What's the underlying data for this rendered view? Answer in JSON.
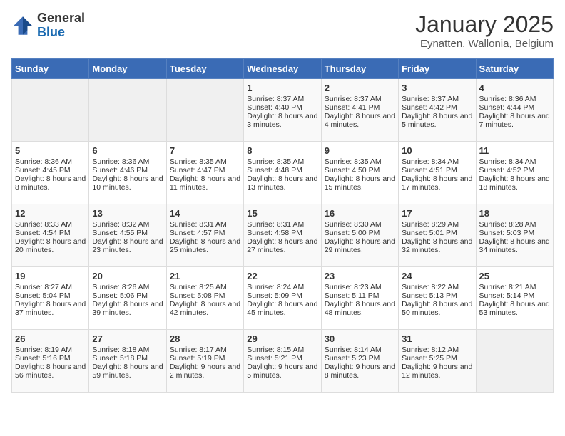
{
  "header": {
    "logo_general": "General",
    "logo_blue": "Blue",
    "month": "January 2025",
    "location": "Eynatten, Wallonia, Belgium"
  },
  "days_of_week": [
    "Sunday",
    "Monday",
    "Tuesday",
    "Wednesday",
    "Thursday",
    "Friday",
    "Saturday"
  ],
  "weeks": [
    [
      {
        "day": "",
        "content": ""
      },
      {
        "day": "",
        "content": ""
      },
      {
        "day": "",
        "content": ""
      },
      {
        "day": "1",
        "content": "Sunrise: 8:37 AM\nSunset: 4:40 PM\nDaylight: 8 hours and 3 minutes."
      },
      {
        "day": "2",
        "content": "Sunrise: 8:37 AM\nSunset: 4:41 PM\nDaylight: 8 hours and 4 minutes."
      },
      {
        "day": "3",
        "content": "Sunrise: 8:37 AM\nSunset: 4:42 PM\nDaylight: 8 hours and 5 minutes."
      },
      {
        "day": "4",
        "content": "Sunrise: 8:36 AM\nSunset: 4:44 PM\nDaylight: 8 hours and 7 minutes."
      }
    ],
    [
      {
        "day": "5",
        "content": "Sunrise: 8:36 AM\nSunset: 4:45 PM\nDaylight: 8 hours and 8 minutes."
      },
      {
        "day": "6",
        "content": "Sunrise: 8:36 AM\nSunset: 4:46 PM\nDaylight: 8 hours and 10 minutes."
      },
      {
        "day": "7",
        "content": "Sunrise: 8:35 AM\nSunset: 4:47 PM\nDaylight: 8 hours and 11 minutes."
      },
      {
        "day": "8",
        "content": "Sunrise: 8:35 AM\nSunset: 4:48 PM\nDaylight: 8 hours and 13 minutes."
      },
      {
        "day": "9",
        "content": "Sunrise: 8:35 AM\nSunset: 4:50 PM\nDaylight: 8 hours and 15 minutes."
      },
      {
        "day": "10",
        "content": "Sunrise: 8:34 AM\nSunset: 4:51 PM\nDaylight: 8 hours and 17 minutes."
      },
      {
        "day": "11",
        "content": "Sunrise: 8:34 AM\nSunset: 4:52 PM\nDaylight: 8 hours and 18 minutes."
      }
    ],
    [
      {
        "day": "12",
        "content": "Sunrise: 8:33 AM\nSunset: 4:54 PM\nDaylight: 8 hours and 20 minutes."
      },
      {
        "day": "13",
        "content": "Sunrise: 8:32 AM\nSunset: 4:55 PM\nDaylight: 8 hours and 23 minutes."
      },
      {
        "day": "14",
        "content": "Sunrise: 8:31 AM\nSunset: 4:57 PM\nDaylight: 8 hours and 25 minutes."
      },
      {
        "day": "15",
        "content": "Sunrise: 8:31 AM\nSunset: 4:58 PM\nDaylight: 8 hours and 27 minutes."
      },
      {
        "day": "16",
        "content": "Sunrise: 8:30 AM\nSunset: 5:00 PM\nDaylight: 8 hours and 29 minutes."
      },
      {
        "day": "17",
        "content": "Sunrise: 8:29 AM\nSunset: 5:01 PM\nDaylight: 8 hours and 32 minutes."
      },
      {
        "day": "18",
        "content": "Sunrise: 8:28 AM\nSunset: 5:03 PM\nDaylight: 8 hours and 34 minutes."
      }
    ],
    [
      {
        "day": "19",
        "content": "Sunrise: 8:27 AM\nSunset: 5:04 PM\nDaylight: 8 hours and 37 minutes."
      },
      {
        "day": "20",
        "content": "Sunrise: 8:26 AM\nSunset: 5:06 PM\nDaylight: 8 hours and 39 minutes."
      },
      {
        "day": "21",
        "content": "Sunrise: 8:25 AM\nSunset: 5:08 PM\nDaylight: 8 hours and 42 minutes."
      },
      {
        "day": "22",
        "content": "Sunrise: 8:24 AM\nSunset: 5:09 PM\nDaylight: 8 hours and 45 minutes."
      },
      {
        "day": "23",
        "content": "Sunrise: 8:23 AM\nSunset: 5:11 PM\nDaylight: 8 hours and 48 minutes."
      },
      {
        "day": "24",
        "content": "Sunrise: 8:22 AM\nSunset: 5:13 PM\nDaylight: 8 hours and 50 minutes."
      },
      {
        "day": "25",
        "content": "Sunrise: 8:21 AM\nSunset: 5:14 PM\nDaylight: 8 hours and 53 minutes."
      }
    ],
    [
      {
        "day": "26",
        "content": "Sunrise: 8:19 AM\nSunset: 5:16 PM\nDaylight: 8 hours and 56 minutes."
      },
      {
        "day": "27",
        "content": "Sunrise: 8:18 AM\nSunset: 5:18 PM\nDaylight: 8 hours and 59 minutes."
      },
      {
        "day": "28",
        "content": "Sunrise: 8:17 AM\nSunset: 5:19 PM\nDaylight: 9 hours and 2 minutes."
      },
      {
        "day": "29",
        "content": "Sunrise: 8:15 AM\nSunset: 5:21 PM\nDaylight: 9 hours and 5 minutes."
      },
      {
        "day": "30",
        "content": "Sunrise: 8:14 AM\nSunset: 5:23 PM\nDaylight: 9 hours and 8 minutes."
      },
      {
        "day": "31",
        "content": "Sunrise: 8:12 AM\nSunset: 5:25 PM\nDaylight: 9 hours and 12 minutes."
      },
      {
        "day": "",
        "content": ""
      }
    ]
  ]
}
